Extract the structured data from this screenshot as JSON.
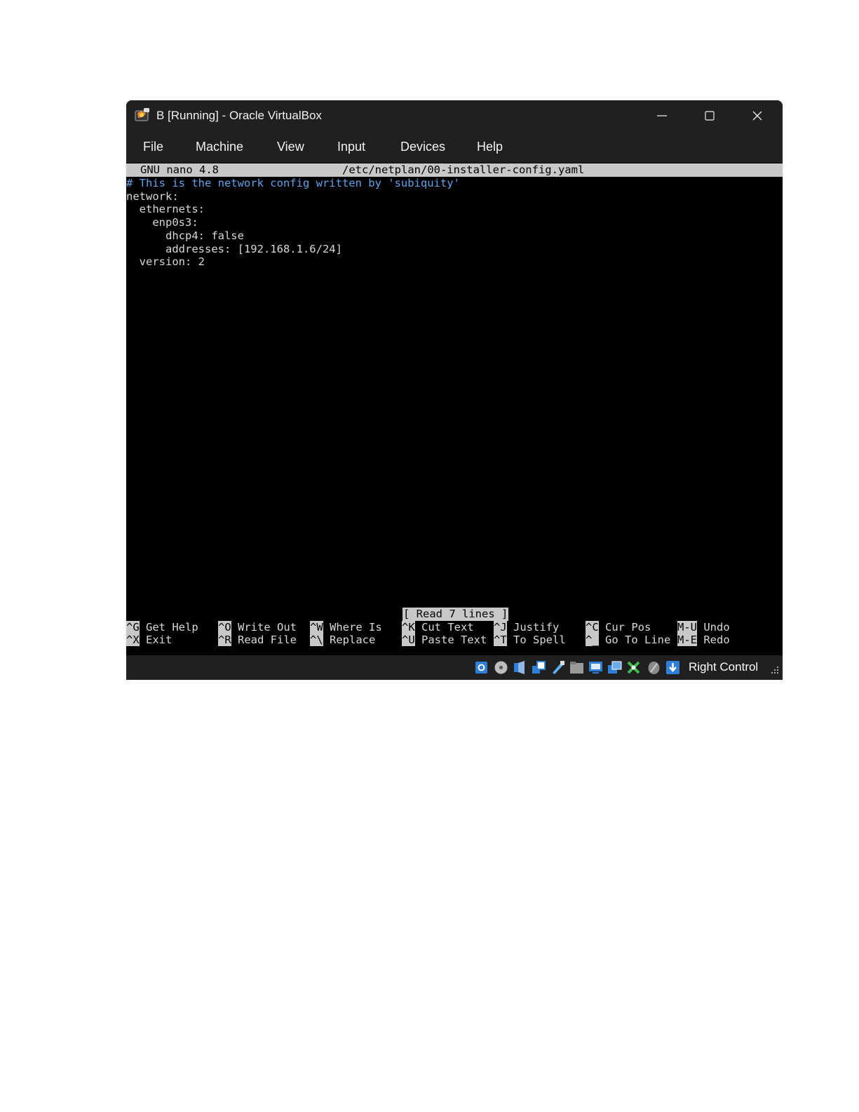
{
  "window": {
    "title": "B [Running] - Oracle VirtualBox",
    "icon": "virtualbox-icon"
  },
  "menu": [
    "File",
    "Machine",
    "View",
    "Input",
    "Devices",
    "Help"
  ],
  "nano": {
    "version": "GNU nano 4.8",
    "filename": "/etc/netplan/00-installer-config.yaml",
    "lines": [
      "# This is the network config written by 'subiquity'",
      "network:",
      "  ethernets:",
      "    enp0s3:",
      "      dhcp4: false",
      "      addresses: [192.168.1.6/24]",
      "  version: 2"
    ],
    "status_message": "[ Read 7 lines ]",
    "shortcuts": [
      [
        {
          "key": "^G",
          "label": "Get Help"
        },
        {
          "key": "^X",
          "label": "Exit"
        }
      ],
      [
        {
          "key": "^O",
          "label": "Write Out"
        },
        {
          "key": "^R",
          "label": "Read File"
        }
      ],
      [
        {
          "key": "^W",
          "label": "Where Is"
        },
        {
          "key": "^\\",
          "label": "Replace"
        }
      ],
      [
        {
          "key": "^K",
          "label": "Cut Text"
        },
        {
          "key": "^U",
          "label": "Paste Text"
        }
      ],
      [
        {
          "key": "^J",
          "label": "Justify"
        },
        {
          "key": "^T",
          "label": "To Spell"
        }
      ],
      [
        {
          "key": "^C",
          "label": "Cur Pos"
        },
        {
          "key": "^_",
          "label": "Go To Line"
        }
      ],
      [
        {
          "key": "M-U",
          "label": "Undo"
        },
        {
          "key": "M-E",
          "label": "Redo"
        }
      ]
    ]
  },
  "statusbar": {
    "icons": [
      "hard-disk-icon",
      "optical-drive-icon",
      "audio-icon",
      "network-icon",
      "usb-icon",
      "shared-folders-icon",
      "display-icon",
      "video-capture-icon",
      "guest-additions-icon",
      "mouse-integration-icon",
      "keyboard-capture-icon"
    ],
    "host_key": "Right Control"
  },
  "colors": {
    "chrome": "#202020",
    "terminal_bg": "#000000",
    "terminal_fg": "#d8d8d8",
    "comment": "#5fa3e8",
    "nano_bar": "#c8c8c8"
  }
}
